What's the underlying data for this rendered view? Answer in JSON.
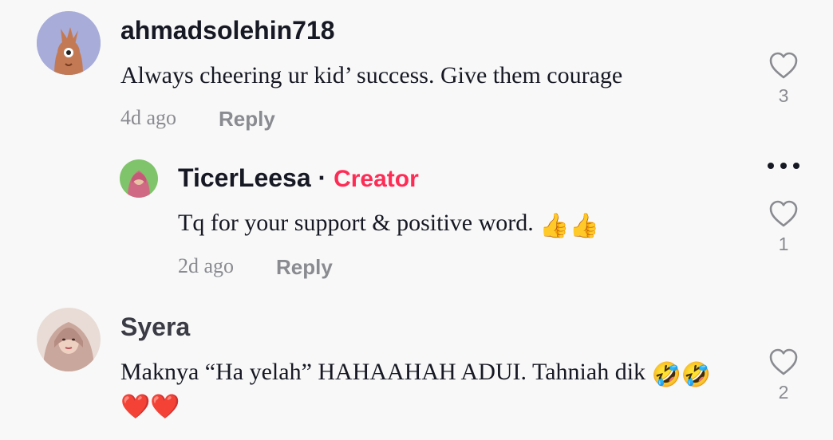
{
  "comments": [
    {
      "username": "ahmadsolehin718",
      "text": "Always cheering ur kid’ success. Give them courage",
      "time": "4d ago",
      "reply_label": "Reply",
      "likes": "3"
    },
    {
      "username": "TicerLeesa",
      "badge_separator": "·",
      "badge": "Creator",
      "text": "Tq for your support & positive word. ",
      "emoji": "👍👍",
      "time": "2d ago",
      "reply_label": "Reply",
      "likes": "1"
    },
    {
      "username": "Syera",
      "text": "Maknya “Ha yelah” HAHAAHAH ADUI. Tahniah dik ",
      "emoji": "🤣🤣",
      "emoji_line2": "❤️❤️",
      "likes": "2"
    }
  ],
  "colors": {
    "background": "#f8f8f8",
    "text": "#161823",
    "muted": "#8a8b91",
    "creator": "#fe2c55"
  },
  "icons": [
    "heart-outline-icon",
    "more-options-icon"
  ]
}
